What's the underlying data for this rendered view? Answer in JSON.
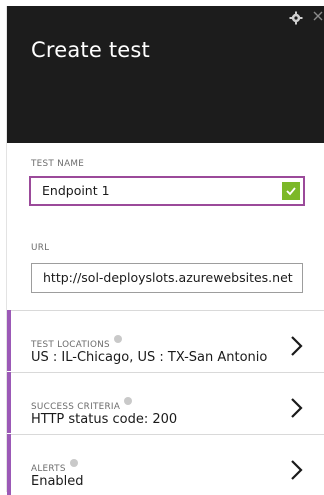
{
  "blade": {
    "title": "Create test",
    "icons": [
      "gear-icon",
      "close-icon"
    ]
  },
  "form": {
    "test_name": {
      "label": "TEST NAME",
      "value": "Endpoint 1"
    },
    "url": {
      "label": "URL",
      "value": "http://sol-deployslots.azurewebsites.net"
    }
  },
  "sections": [
    {
      "label": "TEST LOCATIONS",
      "value": "US : IL-Chicago, US : TX-San Antonio"
    },
    {
      "label": "SUCCESS CRITERIA",
      "value": "HTTP status code: 200"
    },
    {
      "label": "ALERTS",
      "value": "Enabled"
    }
  ],
  "colors": {
    "header_bg": "#1c1c1c",
    "accent_purple": "#9b59b6",
    "check_green": "#7cb828"
  }
}
